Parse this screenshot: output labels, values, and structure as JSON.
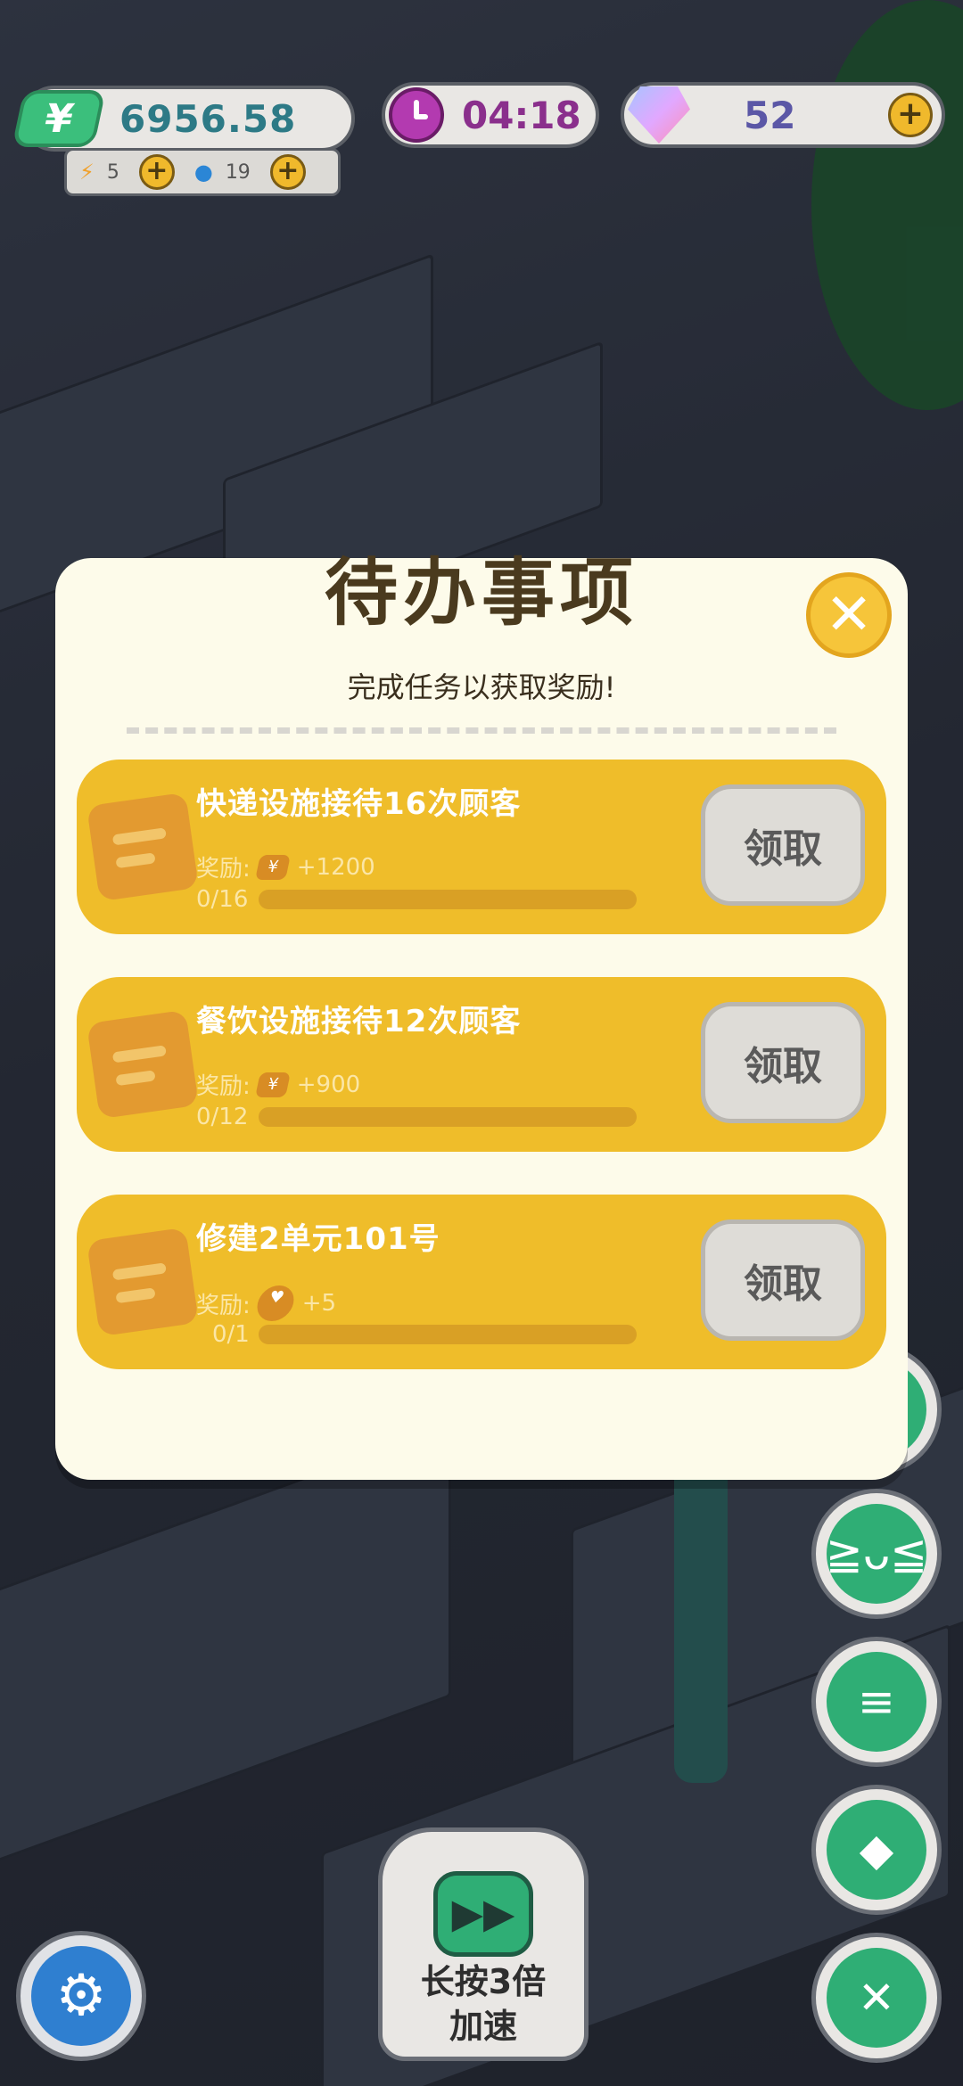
{
  "hud": {
    "money": "6956.58",
    "money_icon": "¥",
    "energy": "5",
    "water": "19",
    "timer": "04:18",
    "gems": "52"
  },
  "modal": {
    "title": "待办事项",
    "subtitle": "完成任务以获取奖励!",
    "tasks": [
      {
        "title": "快递设施接待16次顾客",
        "reward_label": "奖励:",
        "reward_icon": "¥",
        "reward": "+1200",
        "progress_text": "0/16",
        "progress": 0,
        "button": "领取"
      },
      {
        "title": "餐饮设施接待12次顾客",
        "reward_label": "奖励:",
        "reward_icon": "¥",
        "reward": "+900",
        "progress_text": "0/12",
        "progress": 0,
        "button": "领取"
      },
      {
        "title": "修建2单元101号",
        "reward_label": "奖励:",
        "reward_icon": "heart-ticket",
        "reward": "+5",
        "progress_text": "0/1",
        "progress": 0,
        "button": "领取"
      }
    ]
  },
  "speed_button": {
    "label_line1": "长按3倍",
    "label_line2": "加速"
  }
}
